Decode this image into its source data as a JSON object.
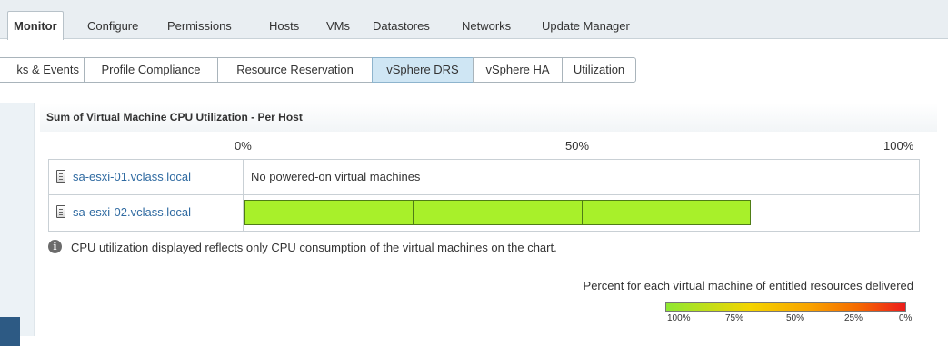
{
  "top_tabs": [
    {
      "label": "Monitor",
      "active": true
    },
    {
      "label": "Configure",
      "active": false
    },
    {
      "label": "Permissions",
      "active": false
    },
    {
      "label": "Hosts",
      "active": false
    },
    {
      "label": "VMs",
      "active": false
    },
    {
      "label": "Datastores",
      "active": false
    },
    {
      "label": "Networks",
      "active": false
    },
    {
      "label": "Update Manager",
      "active": false
    }
  ],
  "sub_tabs": [
    {
      "label": "ks & Events",
      "active": false
    },
    {
      "label": "Profile Compliance",
      "active": false
    },
    {
      "label": "Resource Reservation",
      "active": false
    },
    {
      "label": "vSphere DRS",
      "active": true
    },
    {
      "label": "vSphere HA",
      "active": false
    },
    {
      "label": "Utilization",
      "active": false
    }
  ],
  "chart": {
    "title": "Sum of Virtual Machine CPU Utilization - Per Host",
    "scale_labels": [
      "0%",
      "50%",
      "100%"
    ]
  },
  "hosts": [
    {
      "name": "sa-esxi-01.vclass.local",
      "icon": "server-icon",
      "message": "No powered-on virtual machines"
    },
    {
      "name": "sa-esxi-02.vclass.local",
      "icon": "server-icon"
    }
  ],
  "info": {
    "icon": "info-icon",
    "text": "CPU utilization displayed reflects only CPU consumption of the virtual machines on the chart."
  },
  "legend": {
    "title": "Percent for each virtual machine of entitled resources delivered",
    "ticks": [
      "100%",
      "75%",
      "50%",
      "25%",
      "0%"
    ],
    "colors": [
      "#8fe832",
      "#f4d400",
      "#f9a300",
      "#ec1c1c"
    ]
  },
  "chart_data": {
    "type": "bar",
    "title": "Sum of Virtual Machine CPU Utilization - Per Host",
    "xlim": [
      0,
      100
    ],
    "categories": [
      "sa-esxi-01.vclass.local",
      "sa-esxi-02.vclass.local"
    ],
    "stacks": [
      {
        "host": "sa-esxi-01.vclass.local",
        "segments": []
      },
      {
        "host": "sa-esxi-02.vclass.local",
        "segments": [
          25,
          25,
          25
        ]
      }
    ],
    "bar_color": "#a8f02a"
  }
}
